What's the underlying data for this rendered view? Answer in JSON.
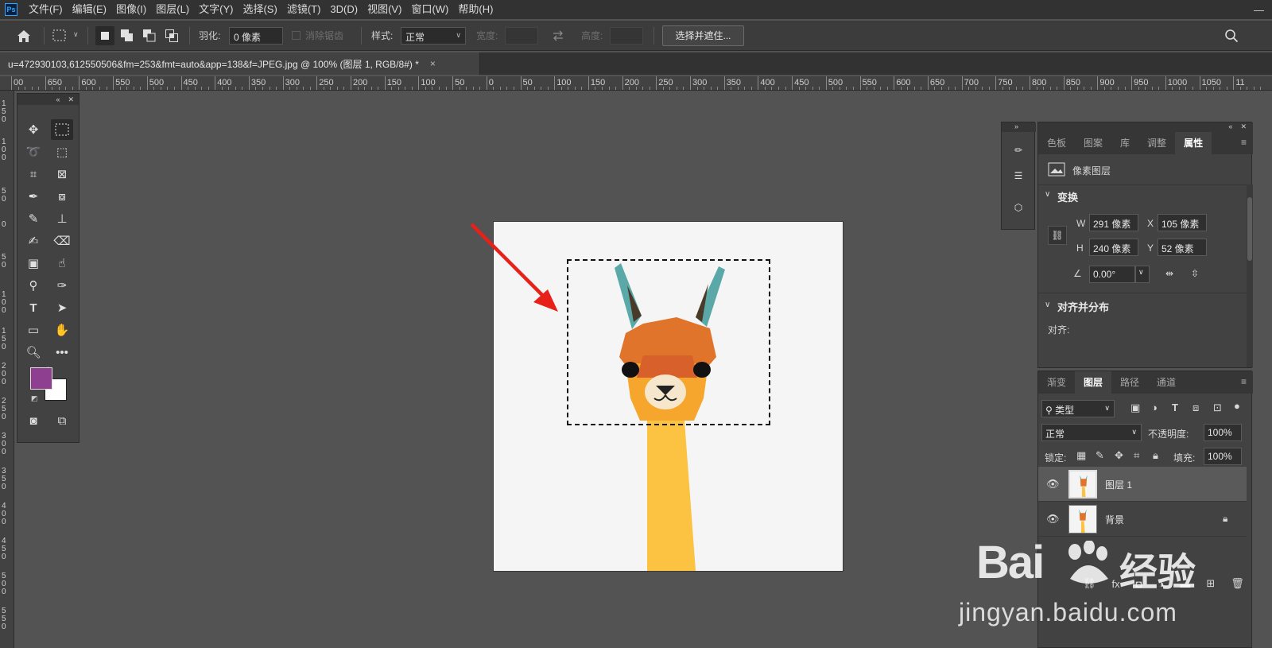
{
  "menubar": {
    "logo": "Ps",
    "items": [
      "文件(F)",
      "编辑(E)",
      "图像(I)",
      "图层(L)",
      "文字(Y)",
      "选择(S)",
      "滤镜(T)",
      "3D(D)",
      "视图(V)",
      "窗口(W)",
      "帮助(H)"
    ],
    "window_controls": [
      "—",
      "□",
      "✕"
    ]
  },
  "options": {
    "feather_label": "羽化:",
    "feather_value": "0 像素",
    "antialias_label": "消除锯齿",
    "style_label": "样式:",
    "style_value": "正常",
    "width_label": "宽度:",
    "height_label": "高度:",
    "select_mask_button": "选择并遮住...",
    "icons": [
      "home-icon",
      "marquee-icon",
      "search-icon"
    ]
  },
  "document": {
    "tab_title": "u=472930103,612550506&fm=253&fmt=auto&app=138&f=JPEG.jpg @ 100% (图层 1, RGB/8#) *",
    "close": "×"
  },
  "ruler": {
    "h_labels": [
      "00",
      "650",
      "600",
      "550",
      "500",
      "450",
      "400",
      "350",
      "300",
      "250",
      "200",
      "150",
      "100",
      "50",
      "0",
      "50",
      "100",
      "150",
      "200",
      "250",
      "300",
      "350",
      "400",
      "450",
      "500",
      "550",
      "600",
      "650",
      "700",
      "750",
      "800",
      "850",
      "900",
      "950",
      "1000",
      "1050",
      "11"
    ]
  },
  "toolbar": {
    "collapse": "«",
    "close": "✕",
    "foreground_color": "#8e3f8f",
    "background_color": "#ffffff"
  },
  "dock": {
    "expand": "»"
  },
  "properties_panel": {
    "tabs": [
      "色板",
      "图案",
      "库",
      "调整",
      "属性"
    ],
    "active_tab": "属性",
    "layer_type": "像素图层",
    "transform_title": "变换",
    "w_label": "W",
    "w_value": "291 像素",
    "h_label": "H",
    "h_value": "240 像素",
    "x_label": "X",
    "x_value": "105 像素",
    "y_label": "Y",
    "y_value": "52 像素",
    "angle_value": "0.00°",
    "align_title": "对齐并分布",
    "align_label": "对齐:",
    "header_controls": [
      "«",
      "✕"
    ]
  },
  "layers_panel": {
    "tabs": [
      "渐变",
      "图层",
      "路径",
      "通道"
    ],
    "active_tab": "图层",
    "filter_label": "类型",
    "blend_mode": "正常",
    "opacity_label": "不透明度:",
    "opacity_value": "100%",
    "lock_label": "锁定:",
    "fill_label": "填充:",
    "fill_value": "100%",
    "layers": [
      {
        "name": "图层 1",
        "selected": true
      },
      {
        "name": "背景",
        "selected": false,
        "locked": true
      }
    ]
  },
  "watermark": {
    "brand": "Bai",
    "brand_suffix": "经验",
    "url": "jingyan.baidu.com"
  },
  "colors": {
    "accent_arrow": "#e8201a",
    "llama_ear": "#5ba8a8",
    "llama_head": "#e0742a",
    "llama_neck": "#fbc341"
  }
}
